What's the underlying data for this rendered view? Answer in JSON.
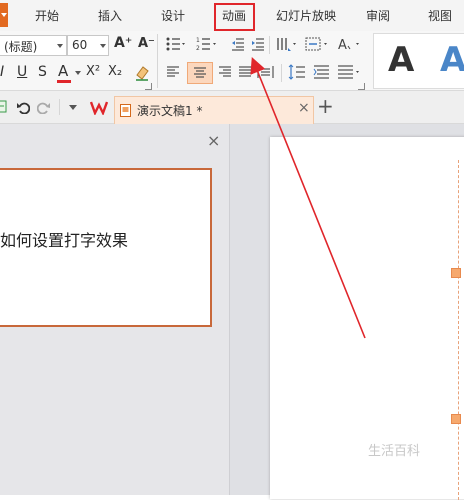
{
  "menu": {
    "items": [
      "开始",
      "插入",
      "设计",
      "动画",
      "幻灯片放映",
      "审阅",
      "视图"
    ],
    "highlighted": "动画"
  },
  "ribbon": {
    "font_name": "(标题)",
    "font_size": "60",
    "font_buttons": [
      "A⁺",
      "A⁻"
    ],
    "style_buttons": [
      "I",
      "U",
      "S",
      "A",
      "X²",
      "X₂"
    ],
    "font_color": "#e0262b",
    "preview_letters": [
      "A",
      "A"
    ],
    "preview_colors": [
      "#111111",
      "#4a86c8"
    ]
  },
  "tabs": {
    "current_doc": "演示文稿1 *",
    "close_label": "×",
    "add_label": "+"
  },
  "panel": {
    "close_label": "×"
  },
  "thumbnail": {
    "text": "如何设置打字效果"
  },
  "annotation": {
    "color": "#e0262b"
  },
  "watermark": {
    "text": "生活百科"
  }
}
